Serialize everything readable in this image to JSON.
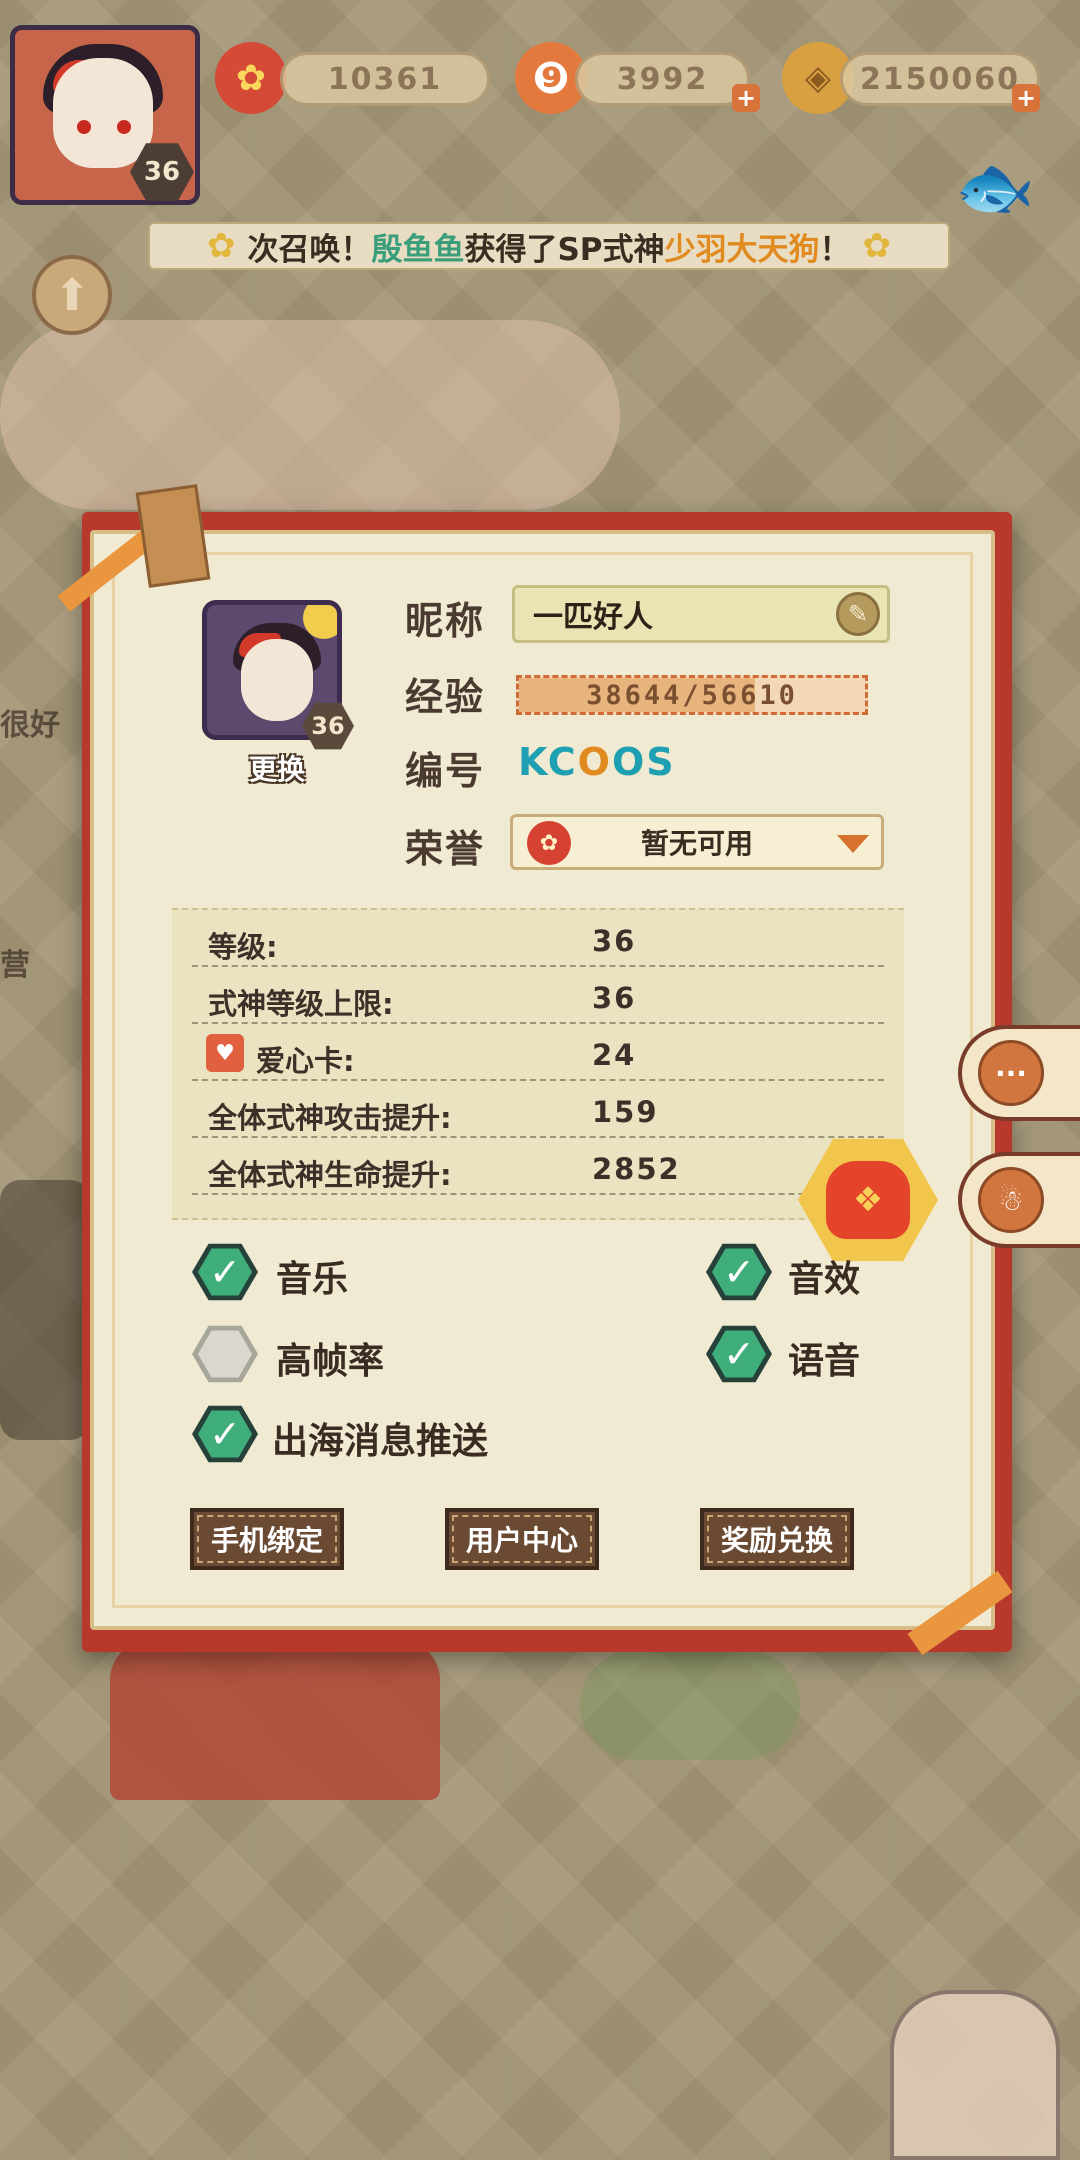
{
  "top_bar": {
    "player_level": "36",
    "currencies": [
      {
        "icon": "plum-flower-icon",
        "value": "10361"
      },
      {
        "icon": "magatama-icon",
        "value": "3992"
      },
      {
        "icon": "coin-icon",
        "value": "2150060"
      }
    ]
  },
  "banner": {
    "prefix": "次召唤！",
    "player": "殷鱼鱼",
    "middle": "获得了SP式神",
    "shikigami": "少羽大天狗",
    "suffix": "！"
  },
  "background": {
    "left_text_1": "很好",
    "left_text_2": "营"
  },
  "profile": {
    "avatar_level": "36",
    "change_label": "更换",
    "nickname_label": "昵称",
    "nickname": "一匹好人",
    "exp_label": "经验",
    "exp_text": "38644/56610",
    "exp_current": 38644,
    "exp_max": 56610,
    "id_label": "编号",
    "id_parts": [
      "KC",
      "O",
      "OS"
    ],
    "honor_label": "荣誉",
    "honor_value": "暂无可用"
  },
  "stats": [
    {
      "label": "等级:",
      "value": "36"
    },
    {
      "label": "式神等级上限:",
      "value": "36"
    },
    {
      "label": "爱心卡:",
      "value": "24",
      "icon": "heart-card-icon"
    },
    {
      "label": "全体式神攻击提升:",
      "value": "159"
    },
    {
      "label": "全体式神生命提升:",
      "value": "2852"
    }
  ],
  "settings": {
    "music": {
      "label": "音乐",
      "checked": true
    },
    "sfx": {
      "label": "音效",
      "checked": true
    },
    "high_fps": {
      "label": "高帧率",
      "checked": false
    },
    "voice": {
      "label": "语音",
      "checked": true
    },
    "sea_push": {
      "label": "出海消息推送",
      "checked": true
    }
  },
  "actions": {
    "phone_bind": "手机绑定",
    "user_center": "用户中心",
    "reward_redeem": "奖励兑换"
  },
  "colors": {
    "panel_bg": "#f1ead2",
    "panel_frame": "#b8382c",
    "check_green": "#3fae7a",
    "id_teal": "#1fa0b2",
    "id_orange": "#e08a20"
  }
}
